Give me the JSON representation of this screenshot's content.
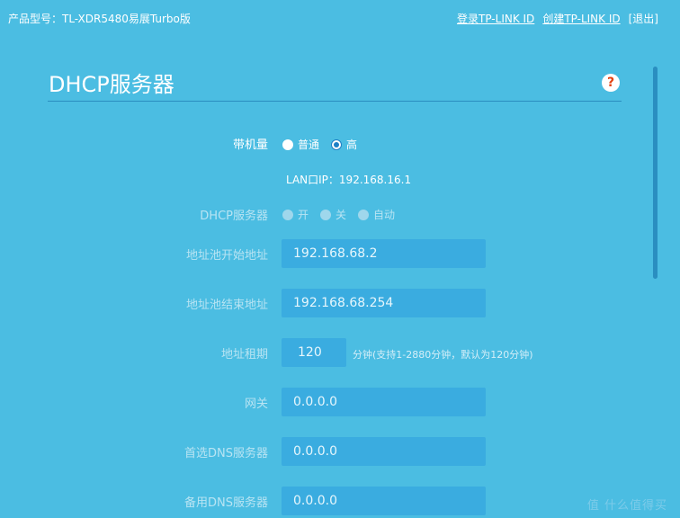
{
  "header": {
    "model_label": "产品型号：TL-XDR5480易展Turbo版",
    "login_link": "登录TP-LINK ID",
    "create_link": "创建TP-LINK ID",
    "logout_link": "[退出]"
  },
  "page": {
    "title": "DHCP服务器",
    "help_symbol": "?"
  },
  "form": {
    "capacity": {
      "label": "带机量",
      "options": [
        {
          "label": "普通",
          "checked": false
        },
        {
          "label": "高",
          "checked": true
        }
      ]
    },
    "lan_ip": "LAN口IP：192.168.16.1",
    "dhcp_server": {
      "label": "DHCP服务器",
      "options": [
        {
          "label": "开",
          "checked": false
        },
        {
          "label": "关",
          "checked": false
        },
        {
          "label": "自动",
          "checked": false
        }
      ]
    },
    "pool_start": {
      "label": "地址池开始地址",
      "value": "192.168.68.2"
    },
    "pool_end": {
      "label": "地址池结束地址",
      "value": "192.168.68.254"
    },
    "lease": {
      "label": "地址租期",
      "value": "120",
      "hint": "分钟(支持1-2880分钟，默认为120分钟)"
    },
    "gateway": {
      "label": "网关",
      "value": "0.0.0.0"
    },
    "dns_primary": {
      "label": "首选DNS服务器",
      "value": "0.0.0.0"
    },
    "dns_secondary": {
      "label": "备用DNS服务器",
      "value": "0.0.0.0"
    }
  },
  "watermark": "值 什么值得买",
  "colors": {
    "background": "#4bbde2",
    "input_bg": "#3aace0",
    "accent": "#1e7fc5",
    "help_icon": "#e4410f"
  }
}
